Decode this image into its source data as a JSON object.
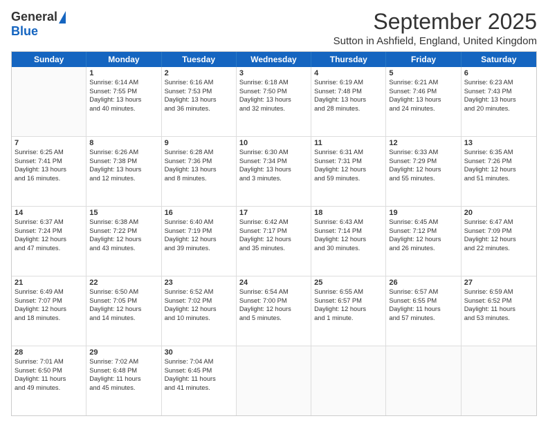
{
  "logo": {
    "general": "General",
    "blue": "Blue"
  },
  "title": "September 2025",
  "location": "Sutton in Ashfield, England, United Kingdom",
  "headers": [
    "Sunday",
    "Monday",
    "Tuesday",
    "Wednesday",
    "Thursday",
    "Friday",
    "Saturday"
  ],
  "weeks": [
    [
      {
        "day": "",
        "lines": []
      },
      {
        "day": "1",
        "lines": [
          "Sunrise: 6:14 AM",
          "Sunset: 7:55 PM",
          "Daylight: 13 hours",
          "and 40 minutes."
        ]
      },
      {
        "day": "2",
        "lines": [
          "Sunrise: 6:16 AM",
          "Sunset: 7:53 PM",
          "Daylight: 13 hours",
          "and 36 minutes."
        ]
      },
      {
        "day": "3",
        "lines": [
          "Sunrise: 6:18 AM",
          "Sunset: 7:50 PM",
          "Daylight: 13 hours",
          "and 32 minutes."
        ]
      },
      {
        "day": "4",
        "lines": [
          "Sunrise: 6:19 AM",
          "Sunset: 7:48 PM",
          "Daylight: 13 hours",
          "and 28 minutes."
        ]
      },
      {
        "day": "5",
        "lines": [
          "Sunrise: 6:21 AM",
          "Sunset: 7:46 PM",
          "Daylight: 13 hours",
          "and 24 minutes."
        ]
      },
      {
        "day": "6",
        "lines": [
          "Sunrise: 6:23 AM",
          "Sunset: 7:43 PM",
          "Daylight: 13 hours",
          "and 20 minutes."
        ]
      }
    ],
    [
      {
        "day": "7",
        "lines": [
          "Sunrise: 6:25 AM",
          "Sunset: 7:41 PM",
          "Daylight: 13 hours",
          "and 16 minutes."
        ]
      },
      {
        "day": "8",
        "lines": [
          "Sunrise: 6:26 AM",
          "Sunset: 7:38 PM",
          "Daylight: 13 hours",
          "and 12 minutes."
        ]
      },
      {
        "day": "9",
        "lines": [
          "Sunrise: 6:28 AM",
          "Sunset: 7:36 PM",
          "Daylight: 13 hours",
          "and 8 minutes."
        ]
      },
      {
        "day": "10",
        "lines": [
          "Sunrise: 6:30 AM",
          "Sunset: 7:34 PM",
          "Daylight: 13 hours",
          "and 3 minutes."
        ]
      },
      {
        "day": "11",
        "lines": [
          "Sunrise: 6:31 AM",
          "Sunset: 7:31 PM",
          "Daylight: 12 hours",
          "and 59 minutes."
        ]
      },
      {
        "day": "12",
        "lines": [
          "Sunrise: 6:33 AM",
          "Sunset: 7:29 PM",
          "Daylight: 12 hours",
          "and 55 minutes."
        ]
      },
      {
        "day": "13",
        "lines": [
          "Sunrise: 6:35 AM",
          "Sunset: 7:26 PM",
          "Daylight: 12 hours",
          "and 51 minutes."
        ]
      }
    ],
    [
      {
        "day": "14",
        "lines": [
          "Sunrise: 6:37 AM",
          "Sunset: 7:24 PM",
          "Daylight: 12 hours",
          "and 47 minutes."
        ]
      },
      {
        "day": "15",
        "lines": [
          "Sunrise: 6:38 AM",
          "Sunset: 7:22 PM",
          "Daylight: 12 hours",
          "and 43 minutes."
        ]
      },
      {
        "day": "16",
        "lines": [
          "Sunrise: 6:40 AM",
          "Sunset: 7:19 PM",
          "Daylight: 12 hours",
          "and 39 minutes."
        ]
      },
      {
        "day": "17",
        "lines": [
          "Sunrise: 6:42 AM",
          "Sunset: 7:17 PM",
          "Daylight: 12 hours",
          "and 35 minutes."
        ]
      },
      {
        "day": "18",
        "lines": [
          "Sunrise: 6:43 AM",
          "Sunset: 7:14 PM",
          "Daylight: 12 hours",
          "and 30 minutes."
        ]
      },
      {
        "day": "19",
        "lines": [
          "Sunrise: 6:45 AM",
          "Sunset: 7:12 PM",
          "Daylight: 12 hours",
          "and 26 minutes."
        ]
      },
      {
        "day": "20",
        "lines": [
          "Sunrise: 6:47 AM",
          "Sunset: 7:09 PM",
          "Daylight: 12 hours",
          "and 22 minutes."
        ]
      }
    ],
    [
      {
        "day": "21",
        "lines": [
          "Sunrise: 6:49 AM",
          "Sunset: 7:07 PM",
          "Daylight: 12 hours",
          "and 18 minutes."
        ]
      },
      {
        "day": "22",
        "lines": [
          "Sunrise: 6:50 AM",
          "Sunset: 7:05 PM",
          "Daylight: 12 hours",
          "and 14 minutes."
        ]
      },
      {
        "day": "23",
        "lines": [
          "Sunrise: 6:52 AM",
          "Sunset: 7:02 PM",
          "Daylight: 12 hours",
          "and 10 minutes."
        ]
      },
      {
        "day": "24",
        "lines": [
          "Sunrise: 6:54 AM",
          "Sunset: 7:00 PM",
          "Daylight: 12 hours",
          "and 5 minutes."
        ]
      },
      {
        "day": "25",
        "lines": [
          "Sunrise: 6:55 AM",
          "Sunset: 6:57 PM",
          "Daylight: 12 hours",
          "and 1 minute."
        ]
      },
      {
        "day": "26",
        "lines": [
          "Sunrise: 6:57 AM",
          "Sunset: 6:55 PM",
          "Daylight: 11 hours",
          "and 57 minutes."
        ]
      },
      {
        "day": "27",
        "lines": [
          "Sunrise: 6:59 AM",
          "Sunset: 6:52 PM",
          "Daylight: 11 hours",
          "and 53 minutes."
        ]
      }
    ],
    [
      {
        "day": "28",
        "lines": [
          "Sunrise: 7:01 AM",
          "Sunset: 6:50 PM",
          "Daylight: 11 hours",
          "and 49 minutes."
        ]
      },
      {
        "day": "29",
        "lines": [
          "Sunrise: 7:02 AM",
          "Sunset: 6:48 PM",
          "Daylight: 11 hours",
          "and 45 minutes."
        ]
      },
      {
        "day": "30",
        "lines": [
          "Sunrise: 7:04 AM",
          "Sunset: 6:45 PM",
          "Daylight: 11 hours",
          "and 41 minutes."
        ]
      },
      {
        "day": "",
        "lines": []
      },
      {
        "day": "",
        "lines": []
      },
      {
        "day": "",
        "lines": []
      },
      {
        "day": "",
        "lines": []
      }
    ]
  ]
}
